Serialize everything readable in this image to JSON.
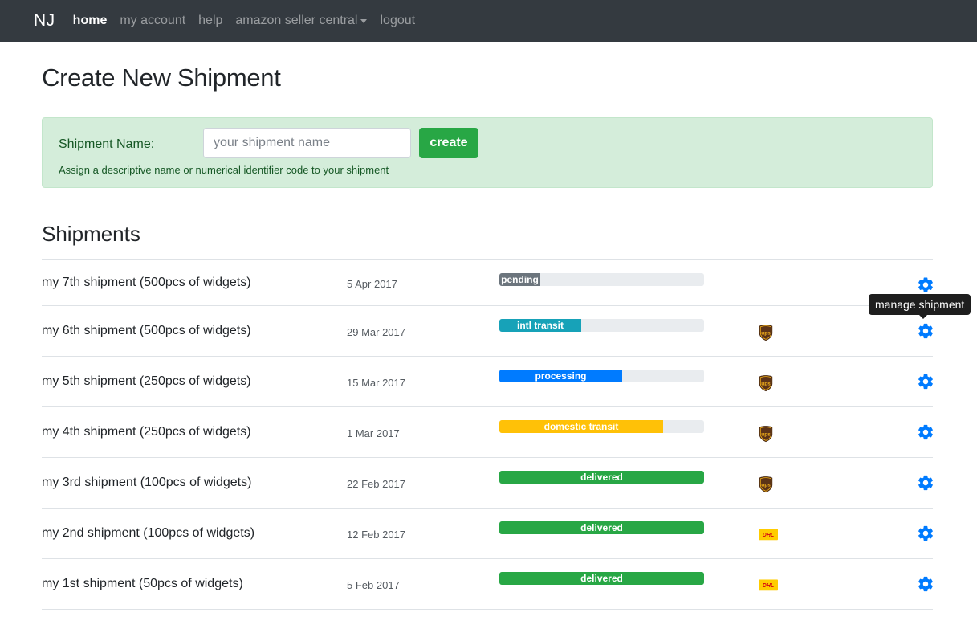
{
  "navbar": {
    "brand": "NJ",
    "links": [
      {
        "label": "home",
        "active": true
      },
      {
        "label": "my account",
        "active": false
      },
      {
        "label": "help",
        "active": false
      },
      {
        "label": "amazon seller central",
        "active": false,
        "dropdown": true
      },
      {
        "label": "logout",
        "active": false
      }
    ]
  },
  "create": {
    "title": "Create New Shipment",
    "label": "Shipment Name:",
    "placeholder": "your shipment name",
    "value": "",
    "button_label": "create",
    "help": "Assign a descriptive name or numerical identifier code to your shipment"
  },
  "shipments": {
    "title": "Shipments",
    "tooltip": "manage shipment",
    "rows": [
      {
        "name": "my 7th shipment (500pcs of widgets)",
        "date": "5 Apr 2017",
        "status": "pending",
        "progress": 0.2,
        "color": "#6c757d",
        "carrier": ""
      },
      {
        "name": "my 6th shipment (500pcs of widgets)",
        "date": "29 Mar 2017",
        "status": "intl transit",
        "progress": 0.4,
        "color": "#17a2b8",
        "carrier": "ups"
      },
      {
        "name": "my 5th shipment (250pcs of widgets)",
        "date": "15 Mar 2017",
        "status": "processing",
        "progress": 0.6,
        "color": "#007bff",
        "carrier": "ups"
      },
      {
        "name": "my 4th shipment (250pcs of widgets)",
        "date": "1 Mar 2017",
        "status": "domestic transit",
        "progress": 0.8,
        "color": "#ffc107",
        "carrier": "ups"
      },
      {
        "name": "my 3rd shipment (100pcs of widgets)",
        "date": "22 Feb 2017",
        "status": "delivered",
        "progress": 1.0,
        "color": "#28a745",
        "carrier": "ups"
      },
      {
        "name": "my 2nd shipment (100pcs of widgets)",
        "date": "12 Feb 2017",
        "status": "delivered",
        "progress": 1.0,
        "color": "#28a745",
        "carrier": "dhl"
      },
      {
        "name": "my 1st shipment (50pcs of widgets)",
        "date": "5 Feb 2017",
        "status": "delivered",
        "progress": 1.0,
        "color": "#28a745",
        "carrier": "dhl"
      }
    ]
  },
  "colors": {
    "navbar_bg": "#343a40",
    "success": "#28a745",
    "alert_bg": "#d4edda",
    "gear": "#007bff"
  },
  "icons": {
    "gear": "gear-icon",
    "ups": "ups-logo-icon",
    "dhl": "dhl-logo-icon",
    "dropdown": "caret-down-icon"
  }
}
